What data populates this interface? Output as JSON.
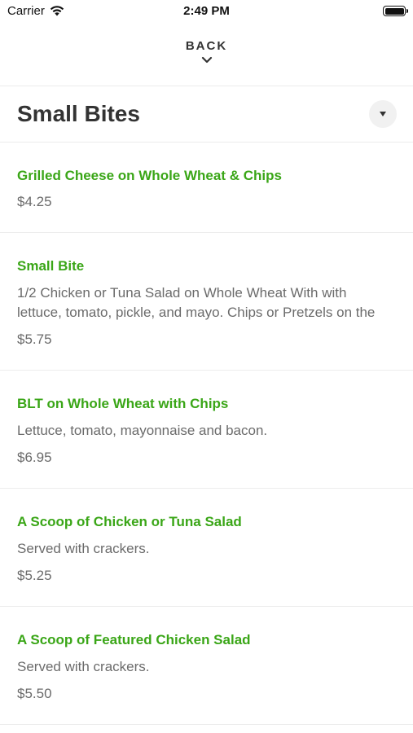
{
  "status_bar": {
    "carrier": "Carrier",
    "time": "2:49 PM"
  },
  "header": {
    "back_label": "BACK"
  },
  "section": {
    "title": "Small Bites"
  },
  "menu_items": [
    {
      "name": "Grilled Cheese on Whole Wheat & Chips",
      "description": "",
      "price": "$4.25"
    },
    {
      "name": "Small Bite",
      "description": "1/2 Chicken or Tuna Salad on Whole Wheat With  with\nlettuce, tomato, pickle, and mayo. Chips or Pretzels on the",
      "price": "$5.75"
    },
    {
      "name": "BLT on Whole Wheat with Chips",
      "description": "Lettuce, tomato, mayonnaise and bacon.",
      "price": "$6.95"
    },
    {
      "name": "A Scoop of Chicken or Tuna Salad",
      "description": "Served with crackers.",
      "price": "$5.25"
    },
    {
      "name": "A Scoop of Featured Chicken Salad",
      "description": "Served with crackers.",
      "price": "$5.50"
    }
  ],
  "colors": {
    "item_name": "#3aa617",
    "text_muted": "#6b6b6b",
    "divider": "#ececec"
  }
}
